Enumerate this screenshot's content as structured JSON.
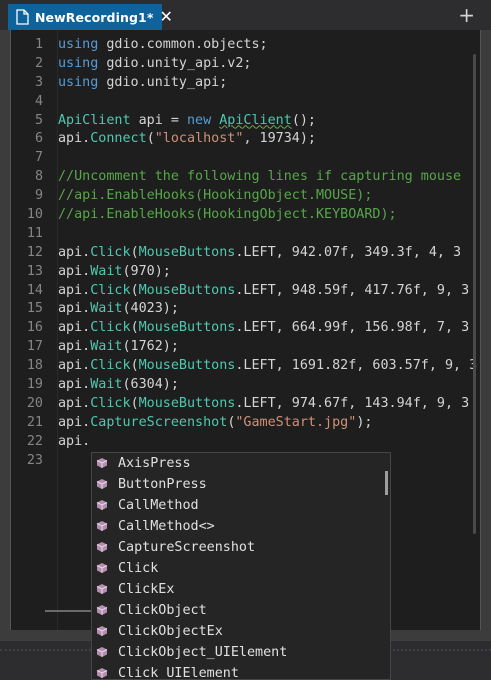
{
  "tab": {
    "title": "NewRecording1*",
    "close": "✕"
  },
  "add_tab": "+",
  "gutter": [
    "1",
    "2",
    "3",
    "4",
    "5",
    "6",
    "7",
    "8",
    "9",
    "10",
    "11",
    "12",
    "13",
    "14",
    "15",
    "16",
    "17",
    "18",
    "19",
    "20",
    "21",
    "22",
    "23"
  ],
  "code": {
    "l1": {
      "kw": "using",
      "rest": " gdio.common.objects;"
    },
    "l2": {
      "kw": "using",
      "rest": " gdio.unity_api.v2;"
    },
    "l3": {
      "kw": "using",
      "rest": " gdio.unity_api;"
    },
    "l5": {
      "cls": "ApiClient",
      "mid": " api = ",
      "kw": "new",
      "sp": " ",
      "cls2": "ApiClient",
      "end": "();"
    },
    "l6": {
      "a": "api.",
      "m": "Connect",
      "p1": "(",
      "s": "\"localhost\"",
      "p2": ", 19734);"
    },
    "l8": "//Uncomment the following lines if capturing mouse",
    "l9": "//api.EnableHooks(HookingObject.MOUSE);",
    "l10": "//api.EnableHooks(HookingObject.KEYBOARD);",
    "l12": {
      "a": "api.",
      "m": "Click",
      "p1": "(",
      "c": "MouseButtons",
      "r": ".LEFT, 942.07f, 349.3f, 4, 3"
    },
    "l13": {
      "a": "api.",
      "m": "Wait",
      "r": "(970);"
    },
    "l14": {
      "a": "api.",
      "m": "Click",
      "p1": "(",
      "c": "MouseButtons",
      "r": ".LEFT, 948.59f, 417.76f, 9, 3"
    },
    "l15": {
      "a": "api.",
      "m": "Wait",
      "r": "(4023);"
    },
    "l16": {
      "a": "api.",
      "m": "Click",
      "p1": "(",
      "c": "MouseButtons",
      "r": ".LEFT, 664.99f, 156.98f, 7, 3"
    },
    "l17": {
      "a": "api.",
      "m": "Wait",
      "r": "(1762);"
    },
    "l18": {
      "a": "api.",
      "m": "Click",
      "p1": "(",
      "c": "MouseButtons",
      "r": ".LEFT, 1691.82f, 603.57f, 9, 3"
    },
    "l19": {
      "a": "api.",
      "m": "Wait",
      "r": "(6304);"
    },
    "l20": {
      "a": "api.",
      "m": "Click",
      "p1": "(",
      "c": "MouseButtons",
      "r": ".LEFT, 974.67f, 143.94f, 9, 3"
    },
    "l21": {
      "a": "api.",
      "m": "CaptureScreenshot",
      "p1": "(",
      "s": "\"GameStart.jpg\"",
      "p2": ");"
    },
    "l22": "api."
  },
  "completion": {
    "items": [
      "AxisPress",
      "ButtonPress",
      "CallMethod",
      "CallMethod<>",
      "CaptureScreenshot",
      "Click",
      "ClickEx",
      "ClickObject",
      "ClickObjectEx",
      "ClickObject_UIElement",
      "Click_UIElement"
    ],
    "icon": "method-cube-icon"
  },
  "colors": {
    "tab_active": "#0e639c",
    "keyword": "#569cd6",
    "type": "#4ec9b0",
    "string": "#ce9178",
    "comment": "#57a64a",
    "editor_bg": "#1e1e1e"
  }
}
